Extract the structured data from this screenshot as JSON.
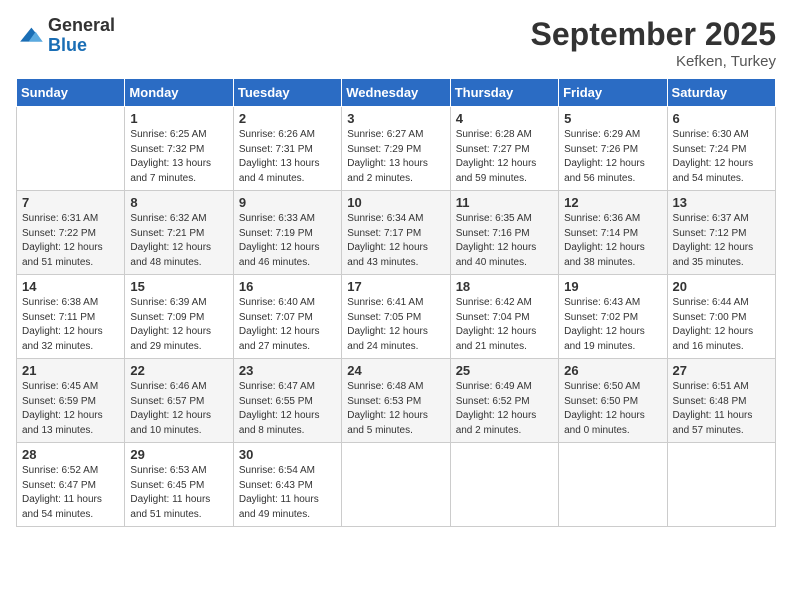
{
  "logo": {
    "general": "General",
    "blue": "Blue"
  },
  "title": "September 2025",
  "subtitle": "Kefken, Turkey",
  "days_header": [
    "Sunday",
    "Monday",
    "Tuesday",
    "Wednesday",
    "Thursday",
    "Friday",
    "Saturday"
  ],
  "weeks": [
    [
      {
        "day": "",
        "info": ""
      },
      {
        "day": "1",
        "info": "Sunrise: 6:25 AM\nSunset: 7:32 PM\nDaylight: 13 hours\nand 7 minutes."
      },
      {
        "day": "2",
        "info": "Sunrise: 6:26 AM\nSunset: 7:31 PM\nDaylight: 13 hours\nand 4 minutes."
      },
      {
        "day": "3",
        "info": "Sunrise: 6:27 AM\nSunset: 7:29 PM\nDaylight: 13 hours\nand 2 minutes."
      },
      {
        "day": "4",
        "info": "Sunrise: 6:28 AM\nSunset: 7:27 PM\nDaylight: 12 hours\nand 59 minutes."
      },
      {
        "day": "5",
        "info": "Sunrise: 6:29 AM\nSunset: 7:26 PM\nDaylight: 12 hours\nand 56 minutes."
      },
      {
        "day": "6",
        "info": "Sunrise: 6:30 AM\nSunset: 7:24 PM\nDaylight: 12 hours\nand 54 minutes."
      }
    ],
    [
      {
        "day": "7",
        "info": "Sunrise: 6:31 AM\nSunset: 7:22 PM\nDaylight: 12 hours\nand 51 minutes."
      },
      {
        "day": "8",
        "info": "Sunrise: 6:32 AM\nSunset: 7:21 PM\nDaylight: 12 hours\nand 48 minutes."
      },
      {
        "day": "9",
        "info": "Sunrise: 6:33 AM\nSunset: 7:19 PM\nDaylight: 12 hours\nand 46 minutes."
      },
      {
        "day": "10",
        "info": "Sunrise: 6:34 AM\nSunset: 7:17 PM\nDaylight: 12 hours\nand 43 minutes."
      },
      {
        "day": "11",
        "info": "Sunrise: 6:35 AM\nSunset: 7:16 PM\nDaylight: 12 hours\nand 40 minutes."
      },
      {
        "day": "12",
        "info": "Sunrise: 6:36 AM\nSunset: 7:14 PM\nDaylight: 12 hours\nand 38 minutes."
      },
      {
        "day": "13",
        "info": "Sunrise: 6:37 AM\nSunset: 7:12 PM\nDaylight: 12 hours\nand 35 minutes."
      }
    ],
    [
      {
        "day": "14",
        "info": "Sunrise: 6:38 AM\nSunset: 7:11 PM\nDaylight: 12 hours\nand 32 minutes."
      },
      {
        "day": "15",
        "info": "Sunrise: 6:39 AM\nSunset: 7:09 PM\nDaylight: 12 hours\nand 29 minutes."
      },
      {
        "day": "16",
        "info": "Sunrise: 6:40 AM\nSunset: 7:07 PM\nDaylight: 12 hours\nand 27 minutes."
      },
      {
        "day": "17",
        "info": "Sunrise: 6:41 AM\nSunset: 7:05 PM\nDaylight: 12 hours\nand 24 minutes."
      },
      {
        "day": "18",
        "info": "Sunrise: 6:42 AM\nSunset: 7:04 PM\nDaylight: 12 hours\nand 21 minutes."
      },
      {
        "day": "19",
        "info": "Sunrise: 6:43 AM\nSunset: 7:02 PM\nDaylight: 12 hours\nand 19 minutes."
      },
      {
        "day": "20",
        "info": "Sunrise: 6:44 AM\nSunset: 7:00 PM\nDaylight: 12 hours\nand 16 minutes."
      }
    ],
    [
      {
        "day": "21",
        "info": "Sunrise: 6:45 AM\nSunset: 6:59 PM\nDaylight: 12 hours\nand 13 minutes."
      },
      {
        "day": "22",
        "info": "Sunrise: 6:46 AM\nSunset: 6:57 PM\nDaylight: 12 hours\nand 10 minutes."
      },
      {
        "day": "23",
        "info": "Sunrise: 6:47 AM\nSunset: 6:55 PM\nDaylight: 12 hours\nand 8 minutes."
      },
      {
        "day": "24",
        "info": "Sunrise: 6:48 AM\nSunset: 6:53 PM\nDaylight: 12 hours\nand 5 minutes."
      },
      {
        "day": "25",
        "info": "Sunrise: 6:49 AM\nSunset: 6:52 PM\nDaylight: 12 hours\nand 2 minutes."
      },
      {
        "day": "26",
        "info": "Sunrise: 6:50 AM\nSunset: 6:50 PM\nDaylight: 12 hours\nand 0 minutes."
      },
      {
        "day": "27",
        "info": "Sunrise: 6:51 AM\nSunset: 6:48 PM\nDaylight: 11 hours\nand 57 minutes."
      }
    ],
    [
      {
        "day": "28",
        "info": "Sunrise: 6:52 AM\nSunset: 6:47 PM\nDaylight: 11 hours\nand 54 minutes."
      },
      {
        "day": "29",
        "info": "Sunrise: 6:53 AM\nSunset: 6:45 PM\nDaylight: 11 hours\nand 51 minutes."
      },
      {
        "day": "30",
        "info": "Sunrise: 6:54 AM\nSunset: 6:43 PM\nDaylight: 11 hours\nand 49 minutes."
      },
      {
        "day": "",
        "info": ""
      },
      {
        "day": "",
        "info": ""
      },
      {
        "day": "",
        "info": ""
      },
      {
        "day": "",
        "info": ""
      }
    ]
  ]
}
